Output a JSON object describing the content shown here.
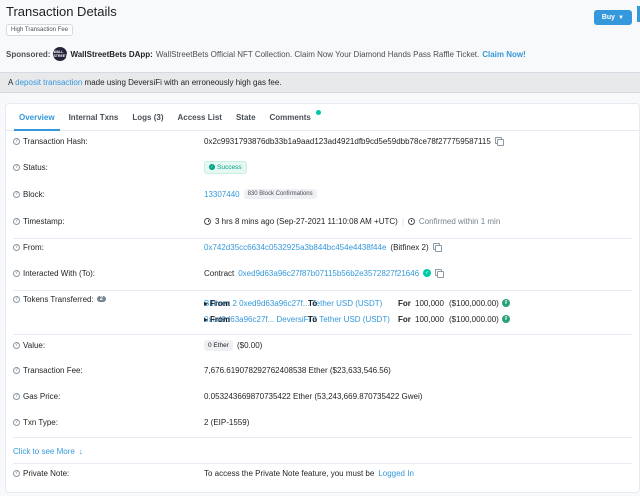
{
  "header": {
    "title": "Transaction Details",
    "badge": "High Transaction Fee",
    "buy_label": "Buy"
  },
  "sponsor": {
    "label": "Sponsored:",
    "logo_text": "WALL STREET",
    "name": "WallStreetBets DApp:",
    "text": "WallStreetBets Official NFT Collection. Claim Now Your Diamond Hands Pass Raffle Ticket.",
    "link": "Claim Now!"
  },
  "notice": {
    "prefix": "A",
    "link": "deposit transaction",
    "suffix": "made using DeversiFi with an erroneously high gas fee."
  },
  "tabs": [
    {
      "label": "Overview"
    },
    {
      "label": "Internal Txns"
    },
    {
      "label": "Logs (3)"
    },
    {
      "label": "Access List"
    },
    {
      "label": "State"
    },
    {
      "label": "Comments"
    }
  ],
  "rows": {
    "hash": {
      "label": "Transaction Hash:",
      "value": "0x2c9931793876db33b1a9aad123ad4921dfb9cd5e59dbb78ce78f277759587115"
    },
    "status": {
      "label": "Status:",
      "value": "Success"
    },
    "block": {
      "label": "Block:",
      "value": "13307440",
      "confirmations": "830 Block Confirmations"
    },
    "timestamp": {
      "label": "Timestamp:",
      "value": "3 hrs 8 mins ago (Sep-27-2021 11:10:08 AM +UTC)",
      "confirmed": "Confirmed within 1 min"
    },
    "from": {
      "label": "From:",
      "address": "0x742d35cc6634c0532925a3b844bc454e4438f44e",
      "name": "(Bitfinex 2)"
    },
    "to": {
      "label": "Interacted With (To):",
      "prefix": "Contract",
      "address": "0xed9d63a96c27f87b07115b56b2e3572827f21646"
    },
    "tokens": {
      "label": "Tokens Transferred:",
      "count": "2",
      "items": [
        {
          "from_label": "From",
          "from": "Bitfinex 2",
          "to_label": "To",
          "to": "0xed9d63a96c27f...",
          "for_label": "For",
          "amount": "100,000",
          "usd": "($100,000.00)",
          "token": "Tether USD (USDT)"
        },
        {
          "from_label": "From",
          "from": "0xed9d63a96c27f...",
          "to_label": "To",
          "to": "DeversiFi 2",
          "for_label": "For",
          "amount": "100,000",
          "usd": "($100,000.00)",
          "token": "Tether USD (USDT)"
        }
      ]
    },
    "value": {
      "label": "Value:",
      "badge": "0 Ether",
      "usd": "($0.00)"
    },
    "fee": {
      "label": "Transaction Fee:",
      "value": "7,676.619078292762408538 Ether ($23,633,546.56)"
    },
    "gas": {
      "label": "Gas Price:",
      "value": "0.053243669870735422 Ether (53,243,669.870735422 Gwei)"
    },
    "type": {
      "label": "Txn Type:",
      "value": "2 (EIP-1559)"
    },
    "more": {
      "label": "Click to see More",
      "arrow": "↓"
    },
    "note": {
      "label": "Private Note:",
      "prefix": "To access the Private Note feature, you must be",
      "link": "Logged In"
    }
  },
  "colors": {
    "accent": "#3498db",
    "success": "#00a186",
    "tether": "#26a17b"
  }
}
